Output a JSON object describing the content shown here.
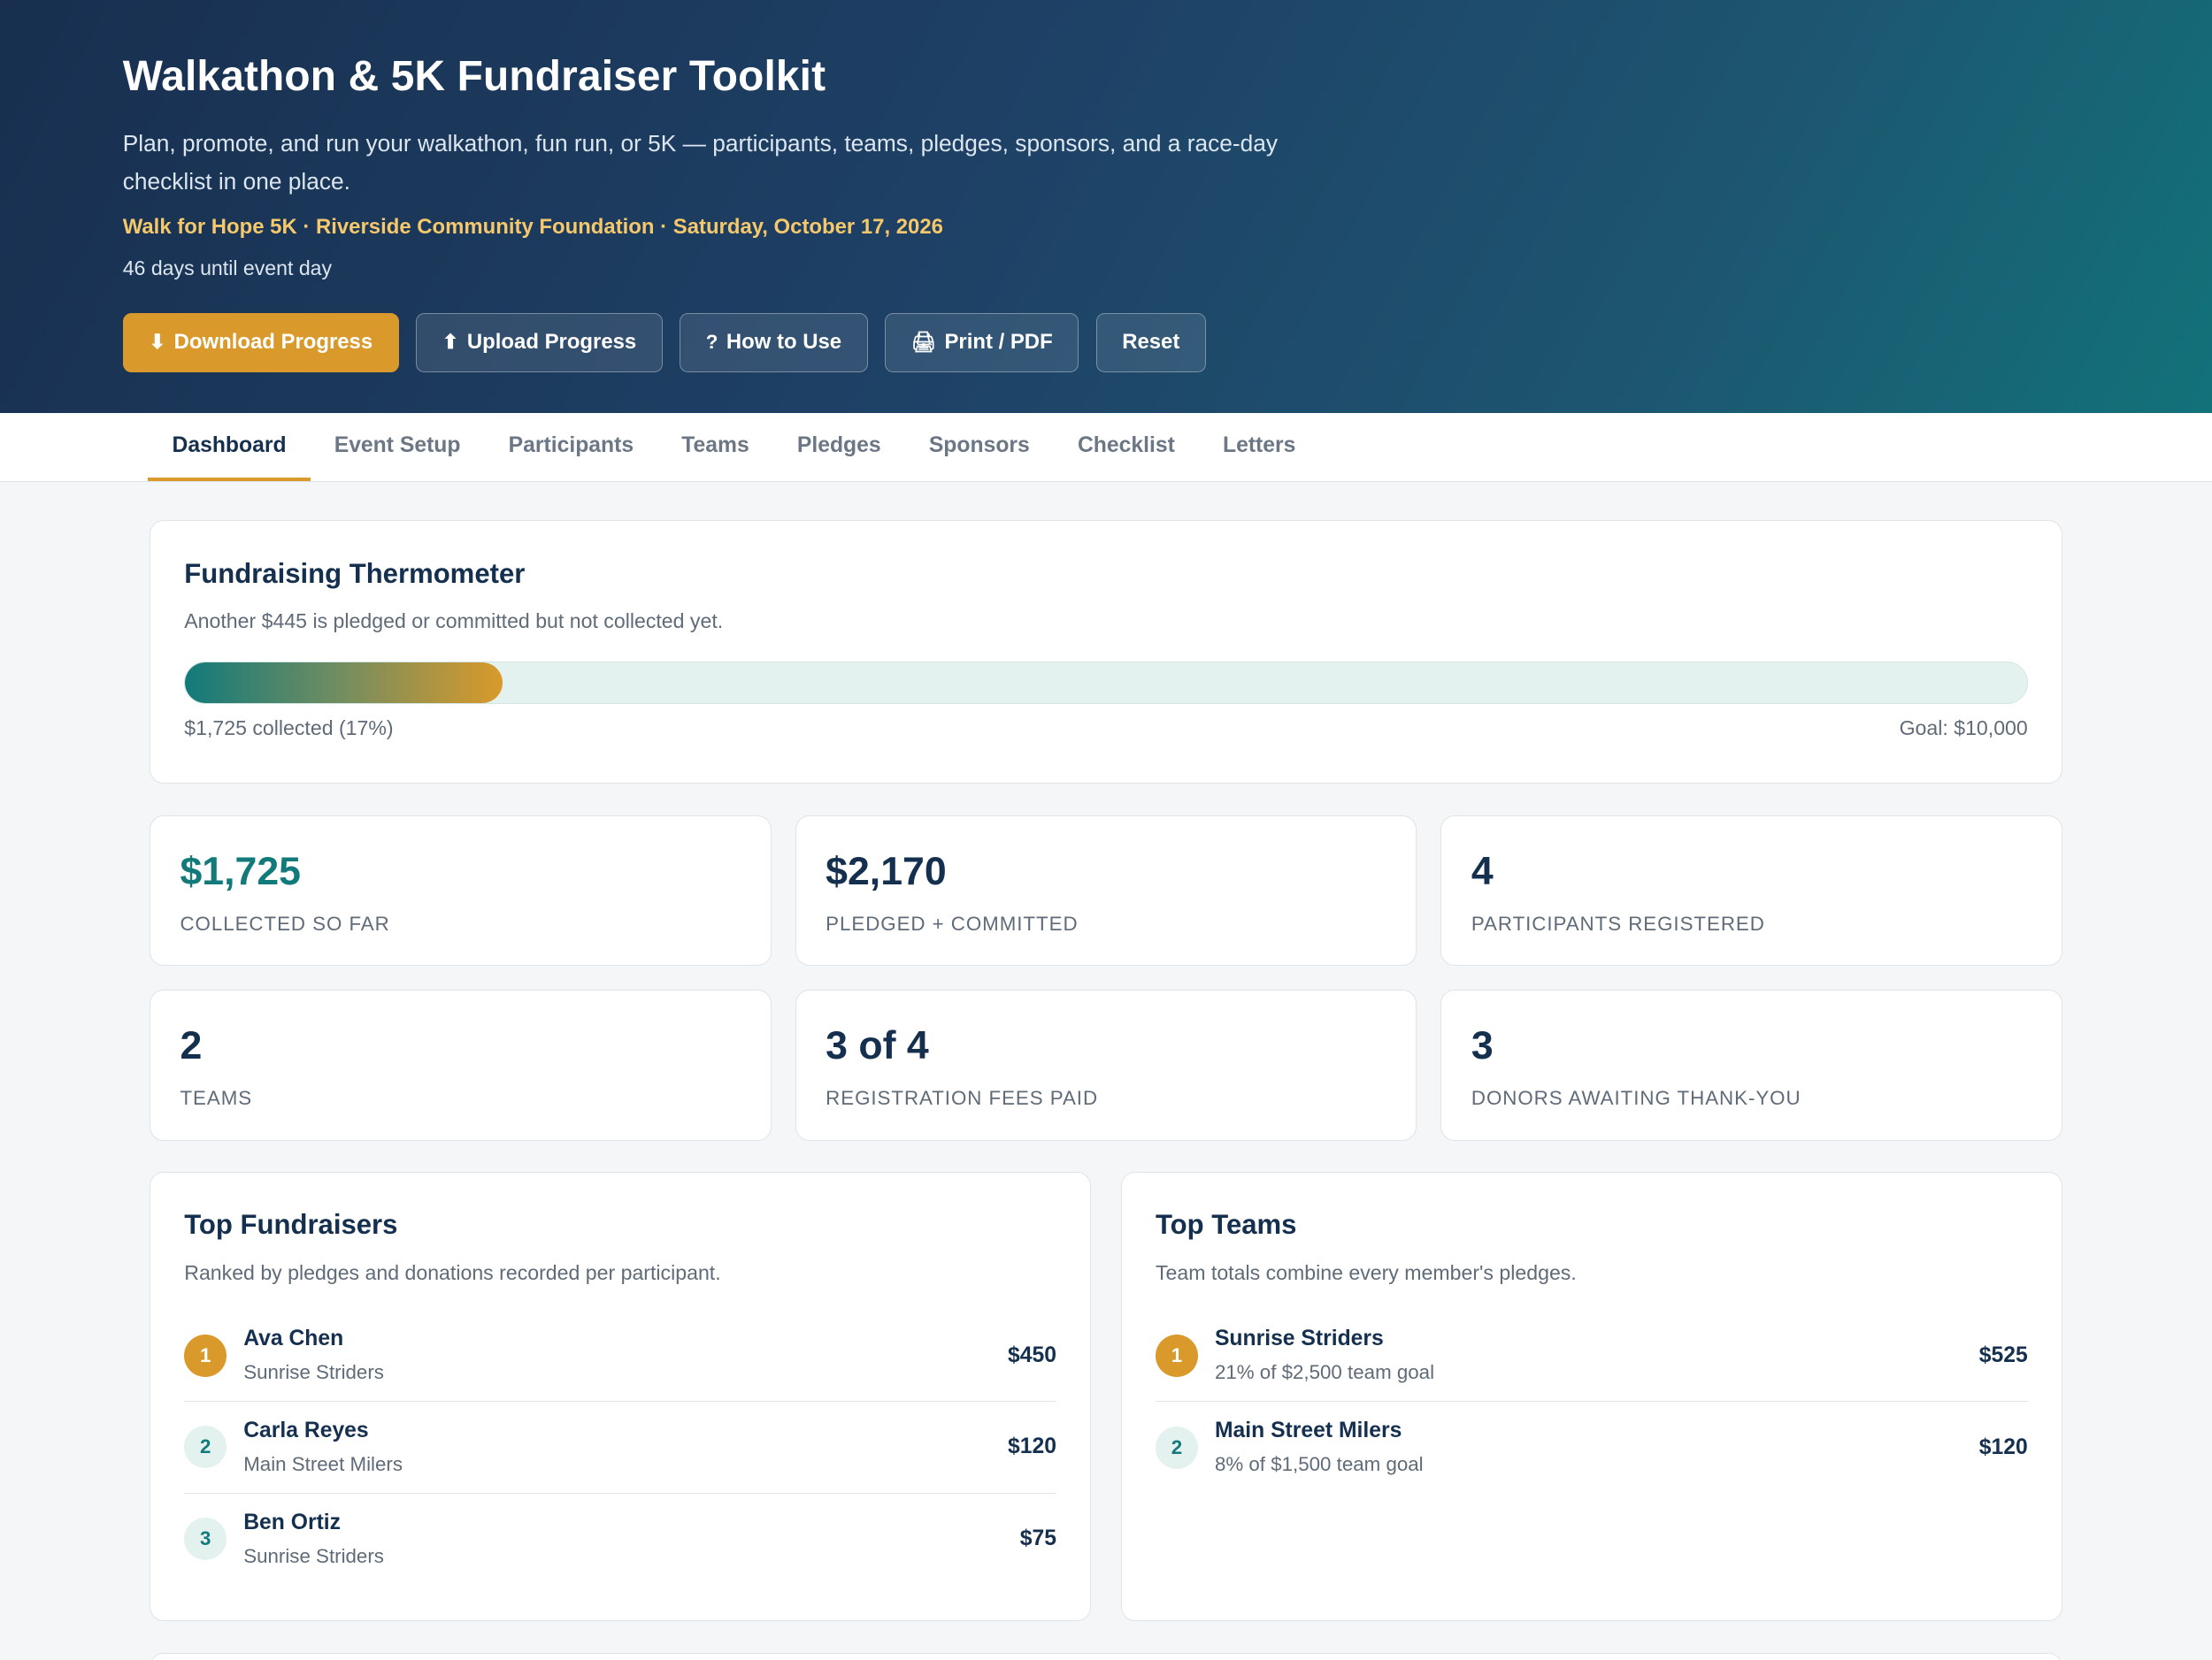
{
  "header": {
    "title": "Walkathon & 5K Fundraiser Toolkit",
    "description": "Plan, promote, and run your walkathon, fun run, or 5K — participants, teams, pledges, sponsors, and a race-day checklist in one place.",
    "event_line": "Walk for Hope 5K · Riverside Community Foundation · Saturday, October 17, 2026",
    "countdown": "46 days until event day",
    "buttons": [
      {
        "icon": "⬇",
        "label": "Download Progress"
      },
      {
        "icon": "⬆",
        "label": "Upload Progress"
      },
      {
        "icon": "?",
        "label": "How to Use"
      },
      {
        "icon": "🖨",
        "label": "Print / PDF"
      },
      {
        "icon": "",
        "label": "Reset"
      }
    ]
  },
  "tabs": [
    {
      "label": "Dashboard",
      "active": true
    },
    {
      "label": "Event Setup"
    },
    {
      "label": "Participants"
    },
    {
      "label": "Teams"
    },
    {
      "label": "Pledges"
    },
    {
      "label": "Sponsors"
    },
    {
      "label": "Checklist"
    },
    {
      "label": "Letters"
    }
  ],
  "thermometer": {
    "title": "Fundraising Thermometer",
    "note": "Another $445 is pledged or committed but not collected yet.",
    "progress_fraction": 0.1725,
    "collected_label": "$1,725 collected (17%)",
    "goal_label": "Goal: $10,000"
  },
  "stats": [
    {
      "value": "$1,725",
      "label": "Collected so far"
    },
    {
      "value": "$2,170",
      "label": "Pledged + committed"
    },
    {
      "value": "4",
      "label": "Participants registered"
    },
    {
      "value": "2",
      "label": "Teams"
    },
    {
      "value": "3 of 4",
      "label": "Registration fees paid"
    },
    {
      "value": "3",
      "label": "Donors awaiting thank-you"
    }
  ],
  "top_fundraisers": {
    "title": "Top Fundraisers",
    "subtitle": "Ranked by pledges and donations recorded per participant.",
    "rows": [
      {
        "rank": "1",
        "name": "Ava Chen",
        "meta": "Sunrise Striders",
        "amount": "$450"
      },
      {
        "rank": "2",
        "name": "Carla Reyes",
        "meta": "Main Street Milers",
        "amount": "$120"
      },
      {
        "rank": "3",
        "name": "Ben Ortiz",
        "meta": "Sunrise Striders",
        "amount": "$75"
      }
    ]
  },
  "top_teams": {
    "title": "Top Teams",
    "subtitle": "Team totals combine every member's pledges.",
    "rows": [
      {
        "rank": "1",
        "name": "Sunrise Striders",
        "meta": "21% of $2,500 team goal",
        "amount": "$525"
      },
      {
        "rank": "2",
        "name": "Main Street Milers",
        "meta": "8% of $1,500 team goal",
        "amount": "$120"
      }
    ]
  },
  "colors": {
    "accent": "#d99a2b",
    "teal": "#127a7a",
    "navy": "#15304f"
  }
}
